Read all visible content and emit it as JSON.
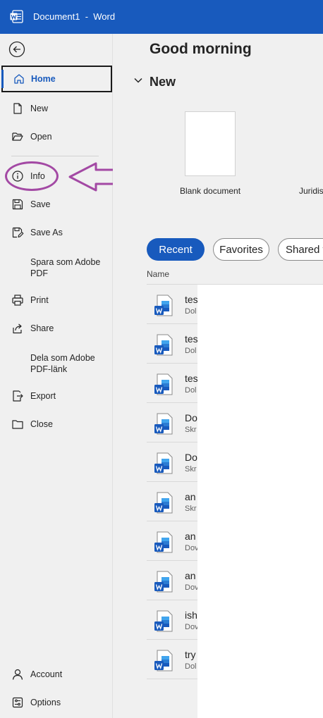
{
  "titlebar": {
    "title": "Document1  -  Word",
    "app_icon": "word-logo-icon",
    "color": "#185abd"
  },
  "sidebar": {
    "back_icon": "back-arrow-icon",
    "items": [
      {
        "label": "Home",
        "icon": "home-icon",
        "selected": true
      },
      {
        "label": "New",
        "icon": "new-document-icon"
      },
      {
        "label": "Open",
        "icon": "folder-open-icon"
      },
      {
        "label": "Info",
        "icon": "info-icon"
      },
      {
        "label": "Save",
        "icon": "save-icon"
      },
      {
        "label": "Save As",
        "icon": "save-as-icon"
      },
      {
        "label": "Spara som Adobe PDF"
      },
      {
        "label": "Print",
        "icon": "printer-icon"
      },
      {
        "label": "Share",
        "icon": "share-icon"
      },
      {
        "label": "Dela som Adobe PDF-länk"
      },
      {
        "label": "Export",
        "icon": "export-icon"
      },
      {
        "label": "Close",
        "icon": "folder-close-icon"
      }
    ],
    "bottom_items": [
      {
        "label": "Account",
        "icon": "person-icon"
      },
      {
        "label": "Options",
        "icon": "options-icon"
      }
    ]
  },
  "annotation": {
    "color": "#a349a4",
    "target": "Info"
  },
  "main": {
    "greeting": "Good morning",
    "new_heading": "New",
    "templates": [
      {
        "label": "Blank document"
      },
      {
        "label": "Juridis"
      }
    ],
    "tabs": [
      {
        "label": "Recent",
        "active": true
      },
      {
        "label": "Favorites"
      },
      {
        "label": "Shared v"
      }
    ],
    "column_name": "Name",
    "files": [
      {
        "name": "tes",
        "location": "Dol"
      },
      {
        "name": "tes",
        "location": "Dol"
      },
      {
        "name": "tes",
        "location": "Dol"
      },
      {
        "name": "Do",
        "location": "Skr"
      },
      {
        "name": "Do",
        "location": "Skr"
      },
      {
        "name": "an",
        "location": "Skr"
      },
      {
        "name": "an",
        "location": "Dov"
      },
      {
        "name": "an",
        "location": "Dov"
      },
      {
        "name": "ish",
        "location": "Dov"
      },
      {
        "name": "try",
        "location": "Dol"
      }
    ]
  }
}
